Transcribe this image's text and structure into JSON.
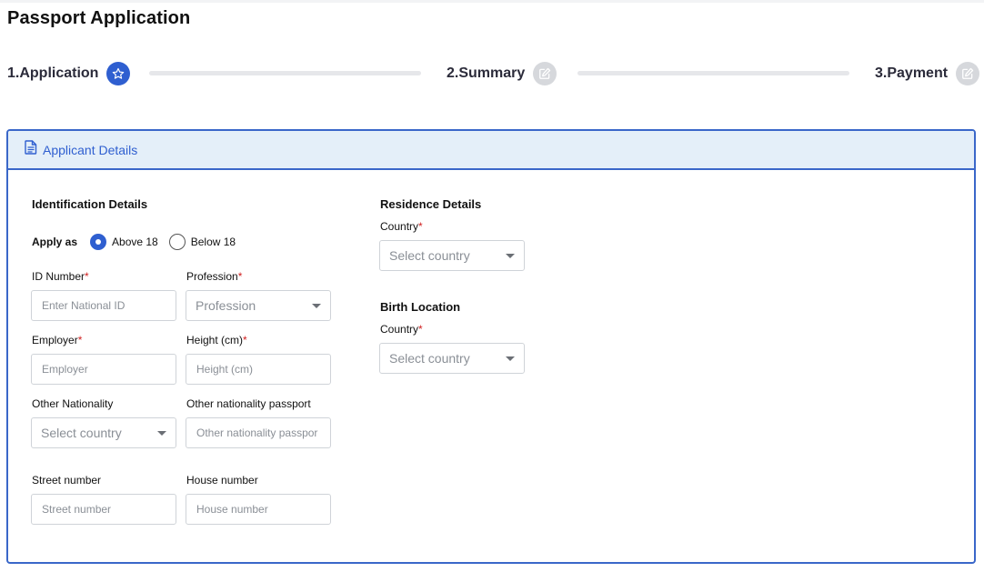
{
  "page": {
    "title": "Passport Application"
  },
  "stepper": {
    "steps": [
      {
        "label": "1.Application",
        "icon": "star-icon",
        "state": "active"
      },
      {
        "label": "2.Summary",
        "icon": "edit-icon",
        "state": "inactive"
      },
      {
        "label": "3.Payment",
        "icon": "edit-icon",
        "state": "inactive"
      }
    ]
  },
  "card": {
    "title": "Applicant Details",
    "icon": "document-icon"
  },
  "identification": {
    "title": "Identification Details",
    "apply_as": {
      "label": "Apply as",
      "options": [
        {
          "label": "Above 18",
          "checked": true
        },
        {
          "label": "Below 18",
          "checked": false
        }
      ]
    },
    "id_number": {
      "label": "ID Number",
      "placeholder": "Enter National ID"
    },
    "profession": {
      "label": "Profession",
      "placeholder": "Profession"
    },
    "employer": {
      "label": "Employer",
      "placeholder": "Employer"
    },
    "height": {
      "label": "Height (cm)",
      "placeholder": "Height (cm)"
    },
    "other_nationality": {
      "label": "Other Nationality",
      "placeholder": "Select country"
    },
    "other_passport": {
      "label": "Other nationality passport",
      "placeholder": "Other nationality passpor"
    },
    "street_number": {
      "label": "Street number",
      "placeholder": "Street number"
    },
    "house_number": {
      "label": "House number",
      "placeholder": "House number"
    },
    "required_mark": "*"
  },
  "residence": {
    "title": "Residence Details",
    "country": {
      "label": "Country",
      "placeholder": "Select country"
    }
  },
  "birth": {
    "title": "Birth Location",
    "country": {
      "label": "Country",
      "placeholder": "Select country"
    }
  },
  "colors": {
    "accent": "#2f5fd0",
    "header_bg": "#e4eff9",
    "required": "#d02020"
  }
}
